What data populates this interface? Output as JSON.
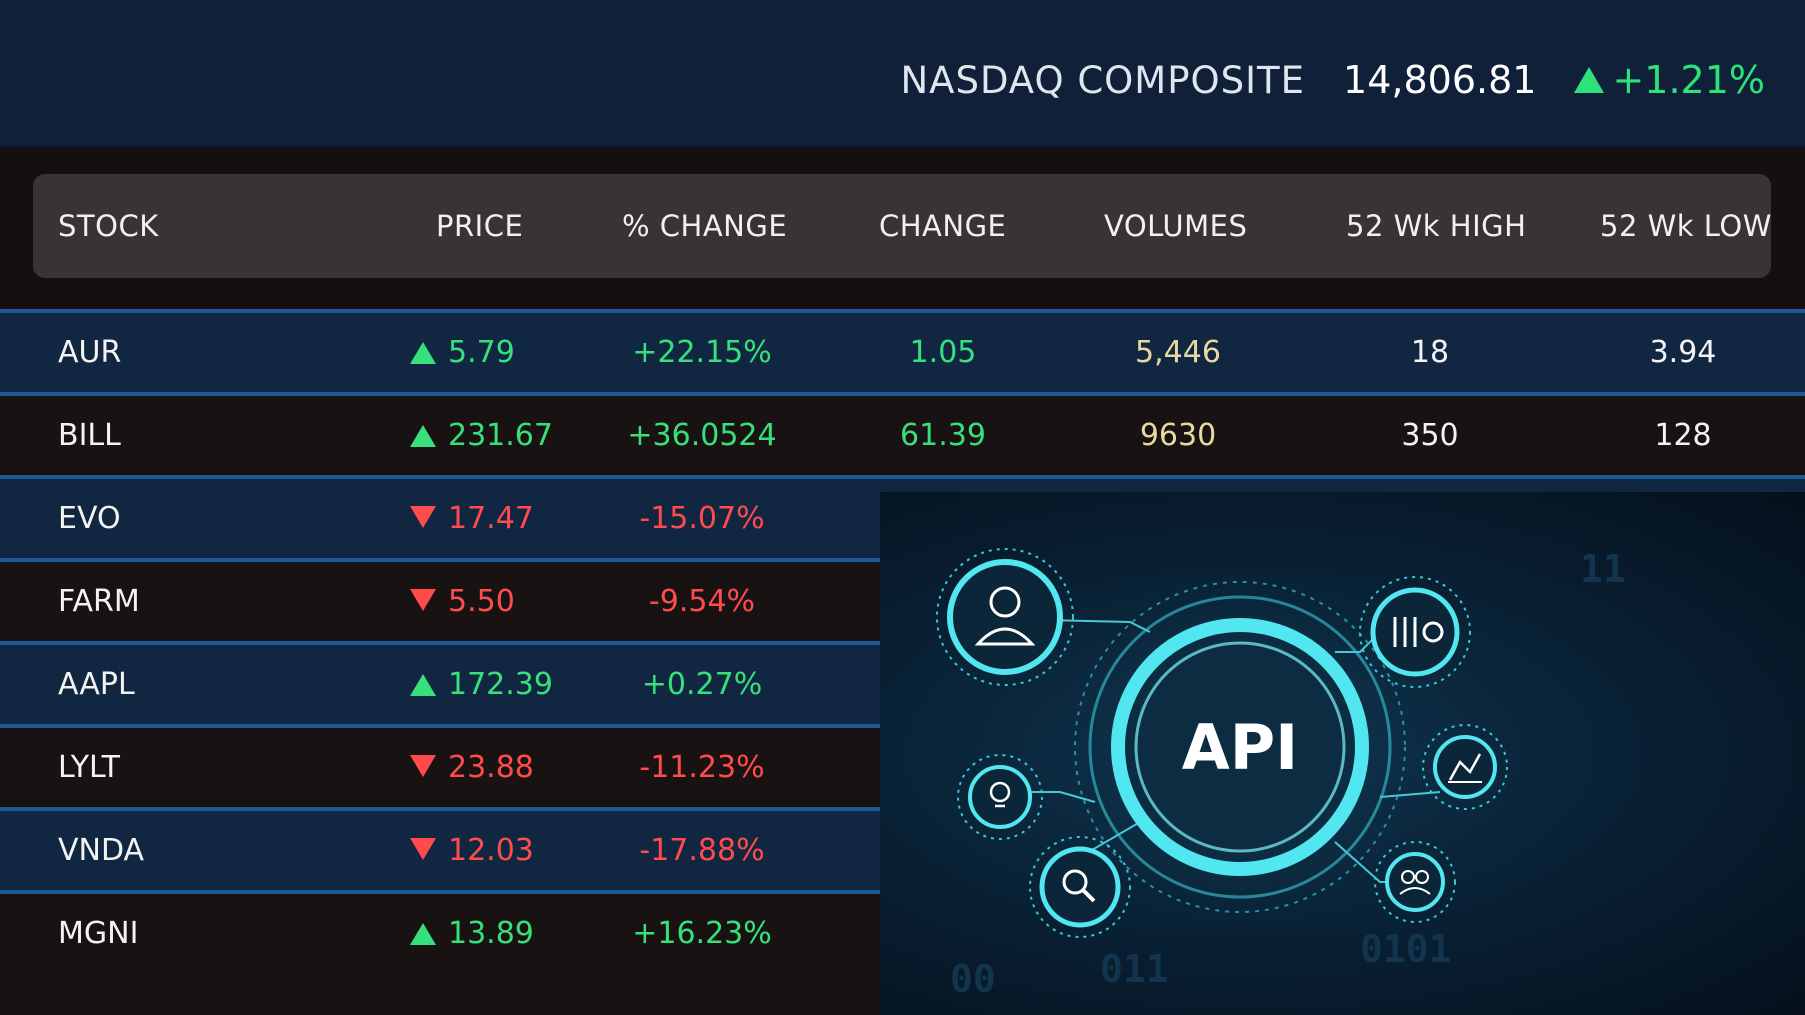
{
  "index": {
    "name": "NASDAQ COMPOSITE",
    "value": "14,806.81",
    "change": "+1.21%",
    "direction": "up"
  },
  "columns": {
    "stock": "STOCK",
    "price": "PRICE",
    "pct_change": "% CHANGE",
    "change": "CHANGE",
    "volumes": "VOLUMES",
    "high52": "52 Wk HIGH",
    "low52": "52 Wk LOW"
  },
  "rows": [
    {
      "symbol": "AUR",
      "direction": "up",
      "price": "5.79",
      "pct": "+22.15%",
      "change": "1.05",
      "volume": "5,446",
      "high": "18",
      "low": "3.94"
    },
    {
      "symbol": "BILL",
      "direction": "up",
      "price": "231.67",
      "pct": "+36.0524",
      "change": "61.39",
      "volume": "9630",
      "high": "350",
      "low": "128"
    },
    {
      "symbol": "EVO",
      "direction": "down",
      "price": "17.47",
      "pct": "-15.07%"
    },
    {
      "symbol": "FARM",
      "direction": "down",
      "price": "5.50",
      "pct": "-9.54%"
    },
    {
      "symbol": "AAPL",
      "direction": "up",
      "price": "172.39",
      "pct": "+0.27%"
    },
    {
      "symbol": "LYLT",
      "direction": "down",
      "price": "23.88",
      "pct": "-11.23%"
    },
    {
      "symbol": "VNDA",
      "direction": "down",
      "price": "12.03",
      "pct": "-17.88%"
    },
    {
      "symbol": "MGNI",
      "direction": "up",
      "price": "13.89",
      "pct": "+16.23%"
    }
  ],
  "overlay": {
    "center_label": "API",
    "icons": [
      "user-icon",
      "settings-sliders-icon",
      "lightbulb-icon",
      "chart-icon",
      "search-icon",
      "team-icon"
    ],
    "background_digits": [
      "00",
      "011",
      "0101",
      "11"
    ]
  },
  "colors": {
    "up": "#37e07a",
    "down": "#ff4b4b",
    "volume": "#e8d9a2",
    "row_blue": "#112641",
    "row_dark": "#191213",
    "divider": "#1d5a95",
    "accent_cyan": "#52e6f0"
  }
}
